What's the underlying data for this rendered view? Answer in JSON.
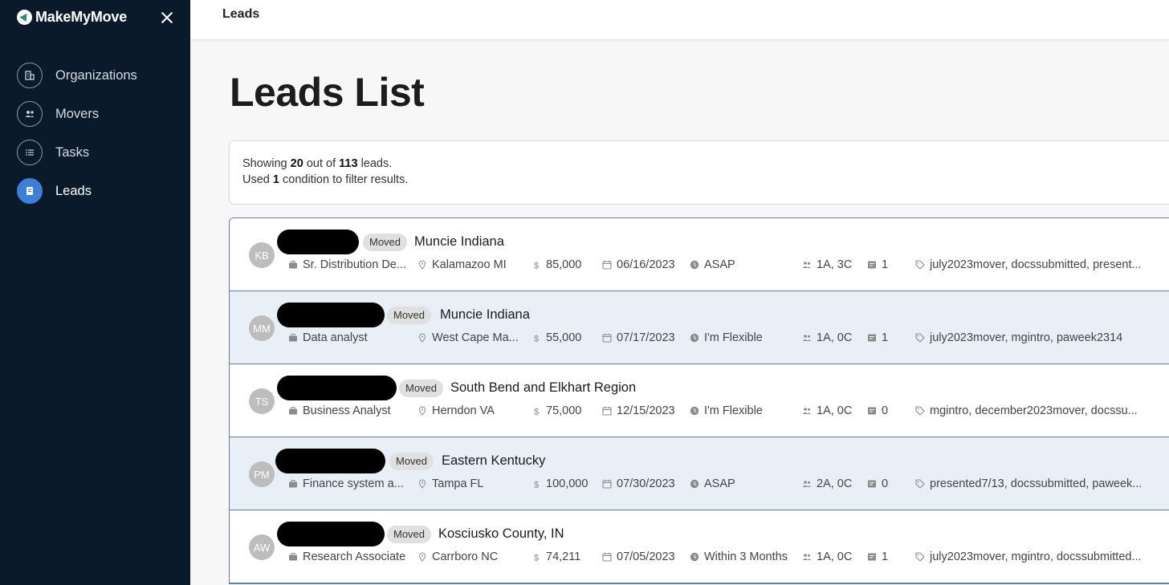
{
  "brand": {
    "name": "MakeMyMove"
  },
  "sidebar": {
    "items": [
      {
        "label": "Organizations",
        "icon": "building-icon",
        "active": false
      },
      {
        "label": "Movers",
        "icon": "people-icon",
        "active": false
      },
      {
        "label": "Tasks",
        "icon": "list-icon",
        "active": false
      },
      {
        "label": "Leads",
        "icon": "document-icon",
        "active": true
      }
    ]
  },
  "topbar": {
    "title": "Leads"
  },
  "page": {
    "title": "Leads List"
  },
  "summary": {
    "line1_prefix": "Showing",
    "shown": "20",
    "line1_mid": "out of",
    "total": "113",
    "line1_suffix": "leads.",
    "line2_prefix": "Used",
    "conditions": "1",
    "line2_suffix": "condition to filter results."
  },
  "leads": [
    {
      "initials": "KB",
      "status": "Moved",
      "location": "Muncie Indiana",
      "job": "Sr. Distribution De...",
      "from": "Kalamazoo MI",
      "salary": "85,000",
      "date": "06/16/2023",
      "timeline": "ASAP",
      "family": "1A, 3C",
      "docs": "1",
      "tags": "july2023mover, docssubmitted, present..."
    },
    {
      "initials": "MM",
      "status": "Moved",
      "location": "Muncie Indiana",
      "job": "Data analyst",
      "from": "West Cape Ma...",
      "salary": "55,000",
      "date": "07/17/2023",
      "timeline": "I'm Flexible",
      "family": "1A, 0C",
      "docs": "1",
      "tags": "july2023mover, mgintro, paweek2314"
    },
    {
      "initials": "TS",
      "status": "Moved",
      "location": "South Bend and Elkhart Region",
      "job": "Business Analyst",
      "from": "Herndon VA",
      "salary": "75,000",
      "date": "12/15/2023",
      "timeline": "I'm Flexible",
      "family": "1A, 0C",
      "docs": "0",
      "tags": "mgintro, december2023mover, docssu..."
    },
    {
      "initials": "PM",
      "status": "Moved",
      "location": "Eastern Kentucky",
      "job": "Finance system a...",
      "from": "Tampa FL",
      "salary": "100,000",
      "date": "07/30/2023",
      "timeline": "ASAP",
      "family": "2A, 0C",
      "docs": "0",
      "tags": "presented7/13, docssubmitted, paweek..."
    },
    {
      "initials": "AW",
      "status": "Moved",
      "location": "Kosciusko County, IN",
      "job": "Research Associate",
      "from": "Carrboro NC",
      "salary": "74,211",
      "date": "07/05/2023",
      "timeline": "Within 3 Months",
      "family": "1A, 0C",
      "docs": "1",
      "tags": "july2023mover, mgintro, docssubmitted..."
    }
  ],
  "colors": {
    "sidebar_bg": "#0b1a2b",
    "accent": "#3c7fd6",
    "row_alt": "#e8eff7"
  }
}
